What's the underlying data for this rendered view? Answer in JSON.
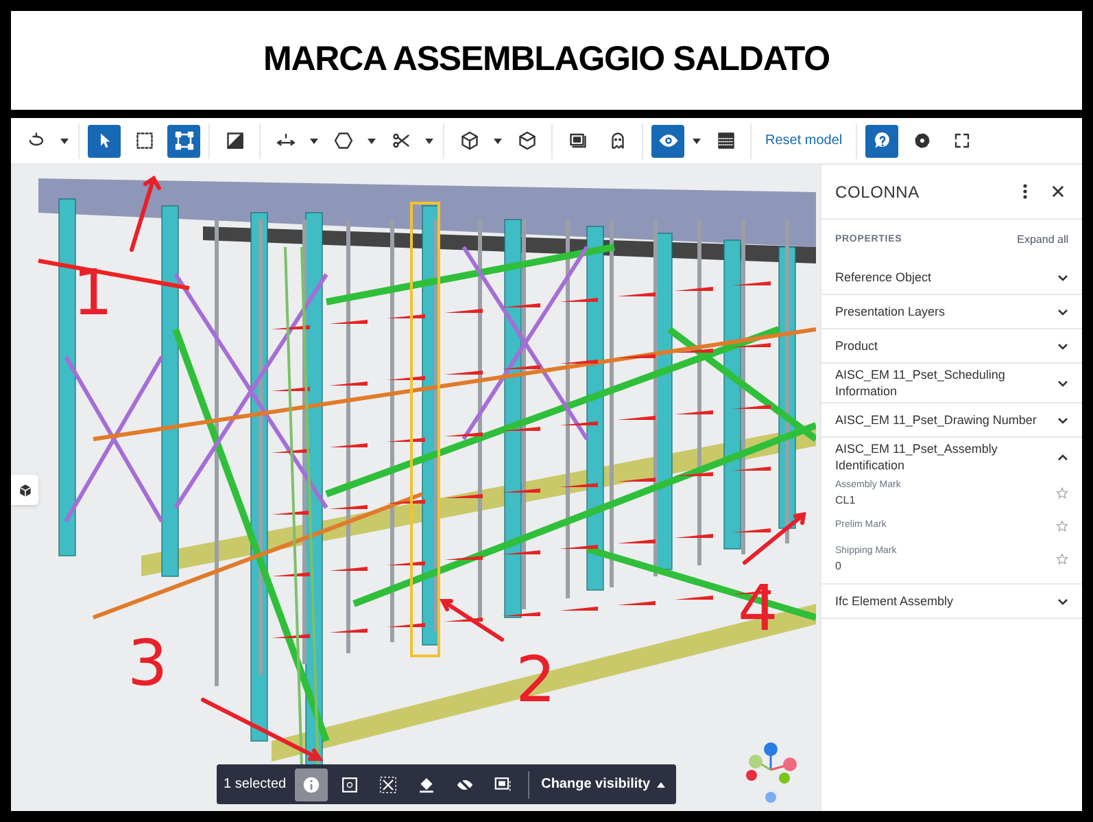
{
  "heading": "MARCA ASSEMBLAGGIO SALDATO",
  "toolbar": {
    "groups": [
      [
        {
          "selected": false,
          "caret": true
        }
      ],
      [
        {
          "selected": true,
          "caret": false
        },
        {
          "selected": false,
          "caret": false
        },
        {
          "selected": true,
          "caret": false
        }
      ],
      [
        {
          "selected": false,
          "caret": false
        }
      ],
      [
        {
          "selected": false,
          "caret": true
        },
        {
          "selected": false,
          "caret": true
        },
        {
          "selected": false,
          "caret": true
        }
      ],
      [
        {
          "selected": false,
          "caret": true
        },
        {
          "selected": false,
          "caret": false
        }
      ],
      [
        {
          "selected": false,
          "caret": false
        },
        {
          "selected": false,
          "caret": false
        }
      ],
      [
        {
          "selected": true,
          "caret": true
        },
        {
          "selected": false,
          "caret": false
        }
      ],
      [
        {
          "kind": "link",
          "label": "Reset model"
        }
      ],
      [
        {
          "selected": true,
          "caret": false
        },
        {
          "selected": false,
          "caret": false
        },
        {
          "selected": false,
          "caret": false
        }
      ]
    ]
  },
  "annotations": [
    "1",
    "4",
    "3",
    "2"
  ],
  "selection_bar": {
    "count": "1 selected",
    "tools": [
      {
        "selected": true
      },
      {
        "selected": false
      },
      {
        "selected": false
      },
      {
        "selected": false
      },
      {
        "selected": false
      },
      {
        "selected": false
      }
    ],
    "menu": "Change visibility"
  },
  "panel": {
    "title": "COLONNA",
    "section_label": "PROPERTIES",
    "expand_all": "Expand all",
    "groups": [
      {
        "label": "Reference Object",
        "expanded": false
      },
      {
        "label": "Presentation Layers",
        "expanded": false
      },
      {
        "label": "Product",
        "expanded": false
      },
      {
        "label": "AISC_EM 11_Pset_Scheduling Information",
        "expanded": false
      },
      {
        "label": "AISC_EM 11_Pset_Drawing Number",
        "expanded": false
      },
      {
        "label": "AISC_EM 11_Pset_Assembly Identification",
        "expanded": true,
        "properties": [
          {
            "name": "Assembly Mark",
            "value": "CL1"
          },
          {
            "name": "Prelim Mark"
          },
          {
            "name": "Shipping Mark",
            "value": "0"
          }
        ]
      },
      {
        "label": "Ifc Element Assembly",
        "expanded": false
      }
    ]
  }
}
